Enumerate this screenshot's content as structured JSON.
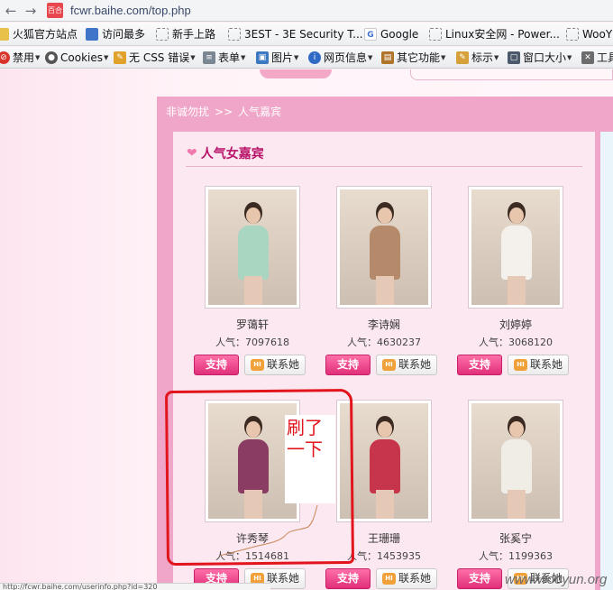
{
  "browser": {
    "url": "fcwr.baihe.com/top.php",
    "favicon_text": "百合",
    "bookmarks": [
      {
        "label": "火狐官方站点",
        "icon": "folder-icon"
      },
      {
        "label": "访问最多",
        "icon": "folder-icon"
      },
      {
        "label": "新手上路",
        "icon": "page-icon"
      },
      {
        "label": "3EST - 3E Security T...",
        "icon": "page-icon"
      },
      {
        "label": "Google",
        "icon": "google-icon"
      },
      {
        "label": "Linux安全网 - Power...",
        "icon": "page-icon"
      },
      {
        "label": "WooY",
        "icon": "page-icon"
      }
    ],
    "webdev_toolbar": [
      {
        "label": "禁用",
        "icon": "disable-icon"
      },
      {
        "label": "Cookies",
        "icon": "cookie-icon"
      },
      {
        "label": "无 CSS 错误",
        "icon": "css-icon"
      },
      {
        "label": "表单",
        "icon": "form-icon"
      },
      {
        "label": "图片",
        "icon": "image-icon"
      },
      {
        "label": "网页信息",
        "icon": "info-icon"
      },
      {
        "label": "其它功能",
        "icon": "misc-icon"
      },
      {
        "label": "标示",
        "icon": "outline-icon"
      },
      {
        "label": "窗口大小",
        "icon": "resize-icon"
      },
      {
        "label": "工具",
        "icon": "tools-icon"
      }
    ],
    "status_text": "http://fcwr.baihe.com/userinfo.php?id=320"
  },
  "page": {
    "breadcrumb": [
      "非诚勿扰",
      "人气嘉宾"
    ],
    "breadcrumb_sep": ">>",
    "section_title": "人气女嘉宾",
    "popularity_label": "人气：",
    "support_label": "支持",
    "contact_label": "联系她",
    "hi_badge": "HI",
    "guests": [
      {
        "name": "罗蔼轩",
        "popularity": "7097618",
        "dress": "#a9d6c0"
      },
      {
        "name": "李诗娴",
        "popularity": "4630237",
        "dress": "#b58a6a"
      },
      {
        "name": "刘婷婷",
        "popularity": "3068120",
        "dress": "#f4f1ec"
      },
      {
        "name": "许秀琴",
        "popularity": "1514681",
        "dress": "#8a3c62"
      },
      {
        "name": "王珊珊",
        "popularity": "1453935",
        "dress": "#c7354a"
      },
      {
        "name": "张奚宁",
        "popularity": "1199363",
        "dress": "#f0ece6"
      }
    ]
  },
  "annotation": {
    "text": "刷了一下"
  },
  "watermark": "www.wooyun.org"
}
